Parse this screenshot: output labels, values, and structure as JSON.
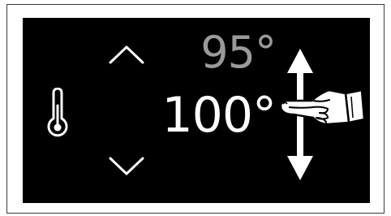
{
  "header": {
    "cut_text": ""
  },
  "display": {
    "previous_temp": "95°",
    "current_temp": "100°"
  },
  "icons": {
    "thermometer": "thermometer-icon",
    "up": "chevron-up-icon",
    "down": "chevron-down-icon",
    "scroll": "vertical-swipe-arrows-icon",
    "hand": "pointing-hand-icon"
  },
  "colors": {
    "screen_bg": "#000000",
    "current_text": "#ffffff",
    "previous_text": "#9a9a9a"
  }
}
